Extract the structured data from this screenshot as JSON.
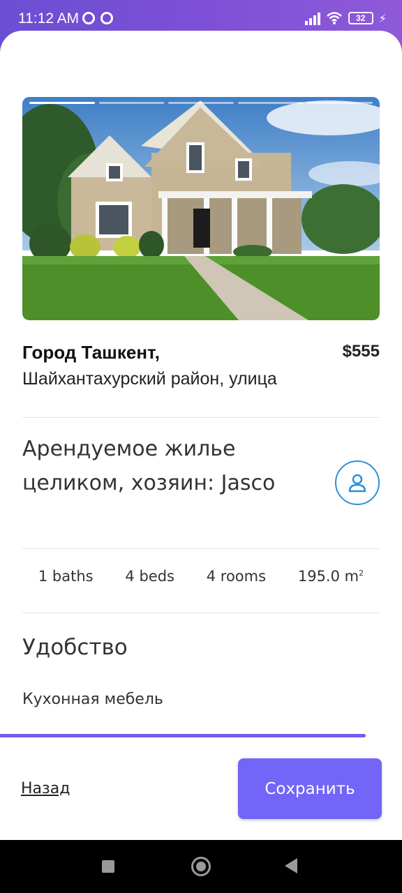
{
  "status_bar": {
    "time": "11:12 AM",
    "battery_level": "32",
    "icons": [
      "app-notification-icon",
      "app-notification-icon",
      "signal-icon",
      "wifi-icon",
      "battery-icon",
      "charging-bolt-icon"
    ]
  },
  "listing": {
    "photo": {
      "alt": "house-photo",
      "slides_total": 5,
      "active_slide": 1
    },
    "city": "Город Ташкент,",
    "street": "Шайхантахурский район, улица",
    "price": "$555",
    "rental_title": "Арендуемое жилье целиком, хозяин: Jasco",
    "host_icon": "user-icon",
    "specs": {
      "baths": "1 baths",
      "beds": "4 beds",
      "rooms": "4 rooms",
      "area_value": "195.0 m",
      "area_unit_sup": "2"
    },
    "amenities": {
      "title": "Удобство",
      "items": [
        "Кухонная мебель"
      ]
    }
  },
  "progress": {
    "fraction": 0.91
  },
  "footer": {
    "back_label": "Назад",
    "save_label": "Сохранить"
  },
  "colors": {
    "brand": "#7365f7",
    "header_gradient": "#6a4fd2",
    "avatar_border": "#2d8fd6"
  }
}
